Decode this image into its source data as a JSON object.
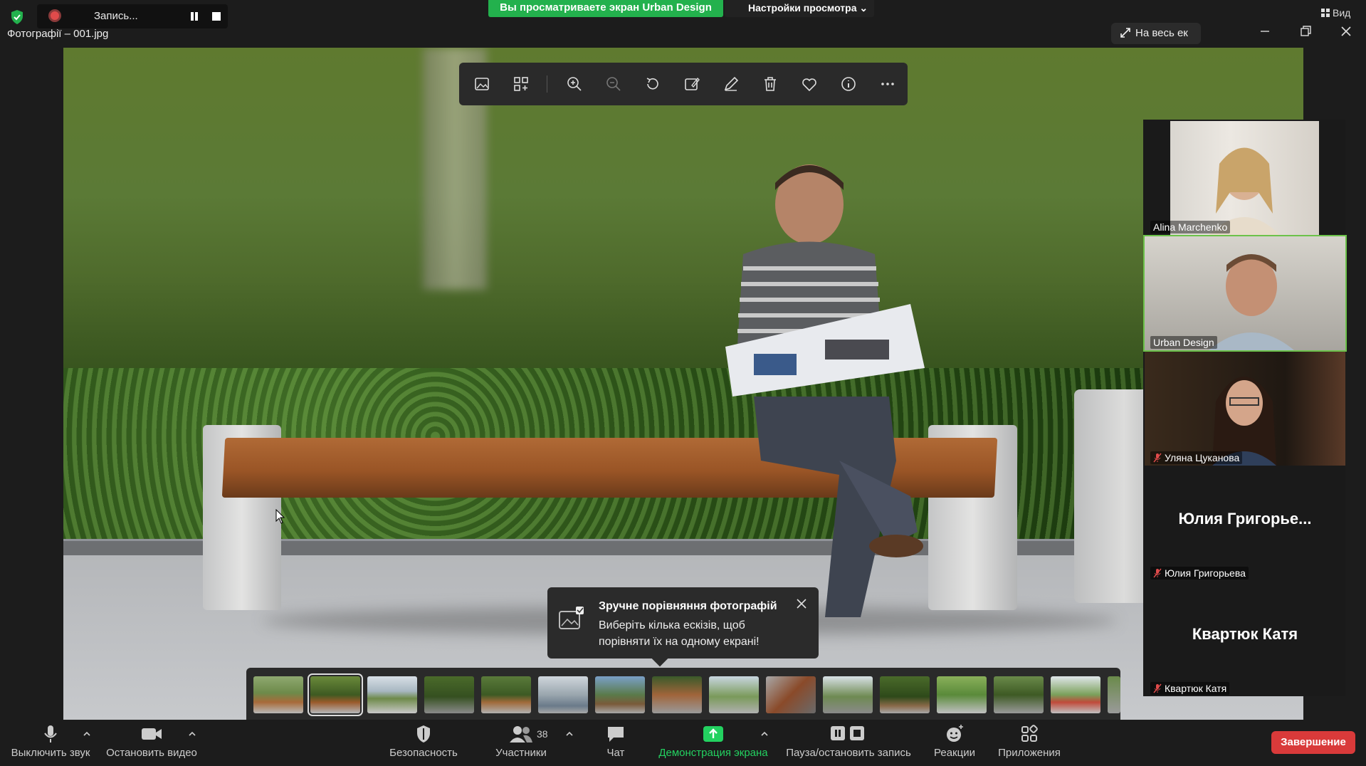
{
  "recording": {
    "label": "Запись..."
  },
  "file": {
    "title": "Фотографії – 001.jpg"
  },
  "share_banner": "Вы просматриваете экран Urban Design",
  "view_settings": "Настройки просмотра",
  "view_button": "Вид",
  "fullscreen_button": "На весь ек",
  "photo_toolbar": {
    "icons": [
      "image-icon",
      "collection-icon",
      "zoom-in-icon",
      "zoom-out-icon",
      "rotate-icon",
      "edit-image-icon",
      "draw-icon",
      "delete-icon",
      "favorite-icon",
      "info-icon",
      "more-icon"
    ]
  },
  "participants": [
    {
      "name": "Alina Marchenko",
      "muted": false
    },
    {
      "name": "Urban Design",
      "muted": false,
      "active": true
    },
    {
      "name": "Уляна Цуканова",
      "muted": true
    },
    {
      "name": "Юлия Григорьева",
      "display": "Юлия Григорье...",
      "muted": true
    },
    {
      "name": "Квартюк Катя",
      "display": "Квартюк Катя",
      "muted": true
    }
  ],
  "toast": {
    "title": "Зручне порівняння фотографій",
    "body": "Виберіть кілька ескізів, щоб порівняти їх на одному екрані!"
  },
  "filmstrip": {
    "count": 15,
    "selected_index": 1
  },
  "bottom_toolbar": {
    "mute": "Выключить звук",
    "video": "Остановить видео",
    "security": "Безопасность",
    "participants": "Участники",
    "participants_count": "38",
    "chat": "Чат",
    "share": "Демонстрация экрана",
    "pause_record": "Пауза/остановить запись",
    "reactions": "Реакции",
    "apps": "Приложения",
    "end": "Завершение"
  },
  "colors": {
    "share_green": "#23b14d",
    "end_red": "#d93a3a",
    "active_speaker": "#6cc24a"
  }
}
